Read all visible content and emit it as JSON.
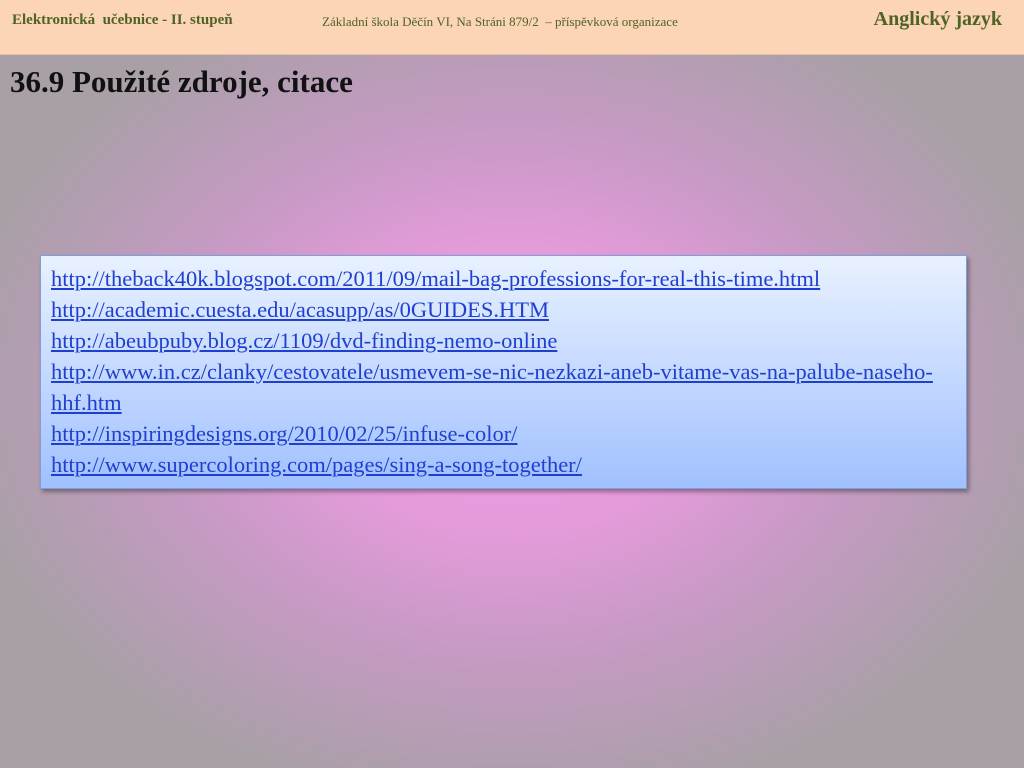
{
  "header": {
    "left": "Elektronická  učebnice - II. stupeň",
    "center": "Základní škola Děčín VI, Na Stráni 879/2  – příspěvková organizace",
    "right": "Anglický jazyk"
  },
  "title": "36.9 Použité zdroje, citace",
  "links": [
    "http://theback40k.blogspot.com/2011/09/mail-bag-professions-for-real-this-time.html",
    "http://academic.cuesta.edu/acasupp/as/0GUIDES.HTM",
    "http://abeubpuby.blog.cz/1109/dvd-finding-nemo-online",
    "http://www.in.cz/clanky/cestovatele/usmevem-se-nic-nezkazi-aneb-vitame-vas-na-palube-naseho-hhf.htm",
    "http://inspiringdesigns.org/2010/02/25/infuse-color/",
    "http://www.supercoloring.com/pages/sing-a-song-together/"
  ]
}
